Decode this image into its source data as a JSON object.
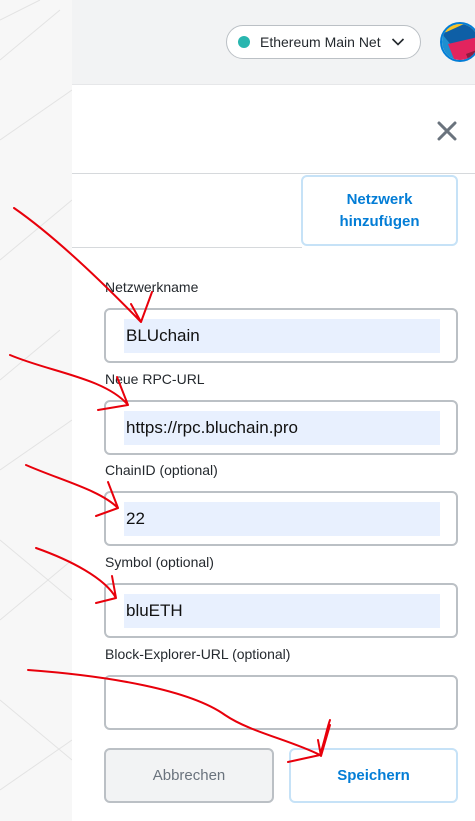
{
  "header": {
    "network_label": "Ethereum Main Net",
    "network_color": "#29b6af"
  },
  "panel": {
    "add_network_label": "Netzwerk hinzufügen"
  },
  "form": {
    "fields": [
      {
        "label": "Netzwerkname",
        "value": "BLUchain"
      },
      {
        "label": "Neue RPC-URL",
        "value": "https://rpc.bluchain.pro"
      },
      {
        "label": "ChainID (optional)",
        "value": "22"
      },
      {
        "label": "Symbol (optional)",
        "value": "bluETH"
      },
      {
        "label": "Block-Explorer-URL (optional)",
        "value": ""
      }
    ]
  },
  "actions": {
    "cancel_label": "Abbrechen",
    "save_label": "Speichern"
  },
  "colors": {
    "accent": "#037dd6",
    "annotation": "#e8000b"
  }
}
